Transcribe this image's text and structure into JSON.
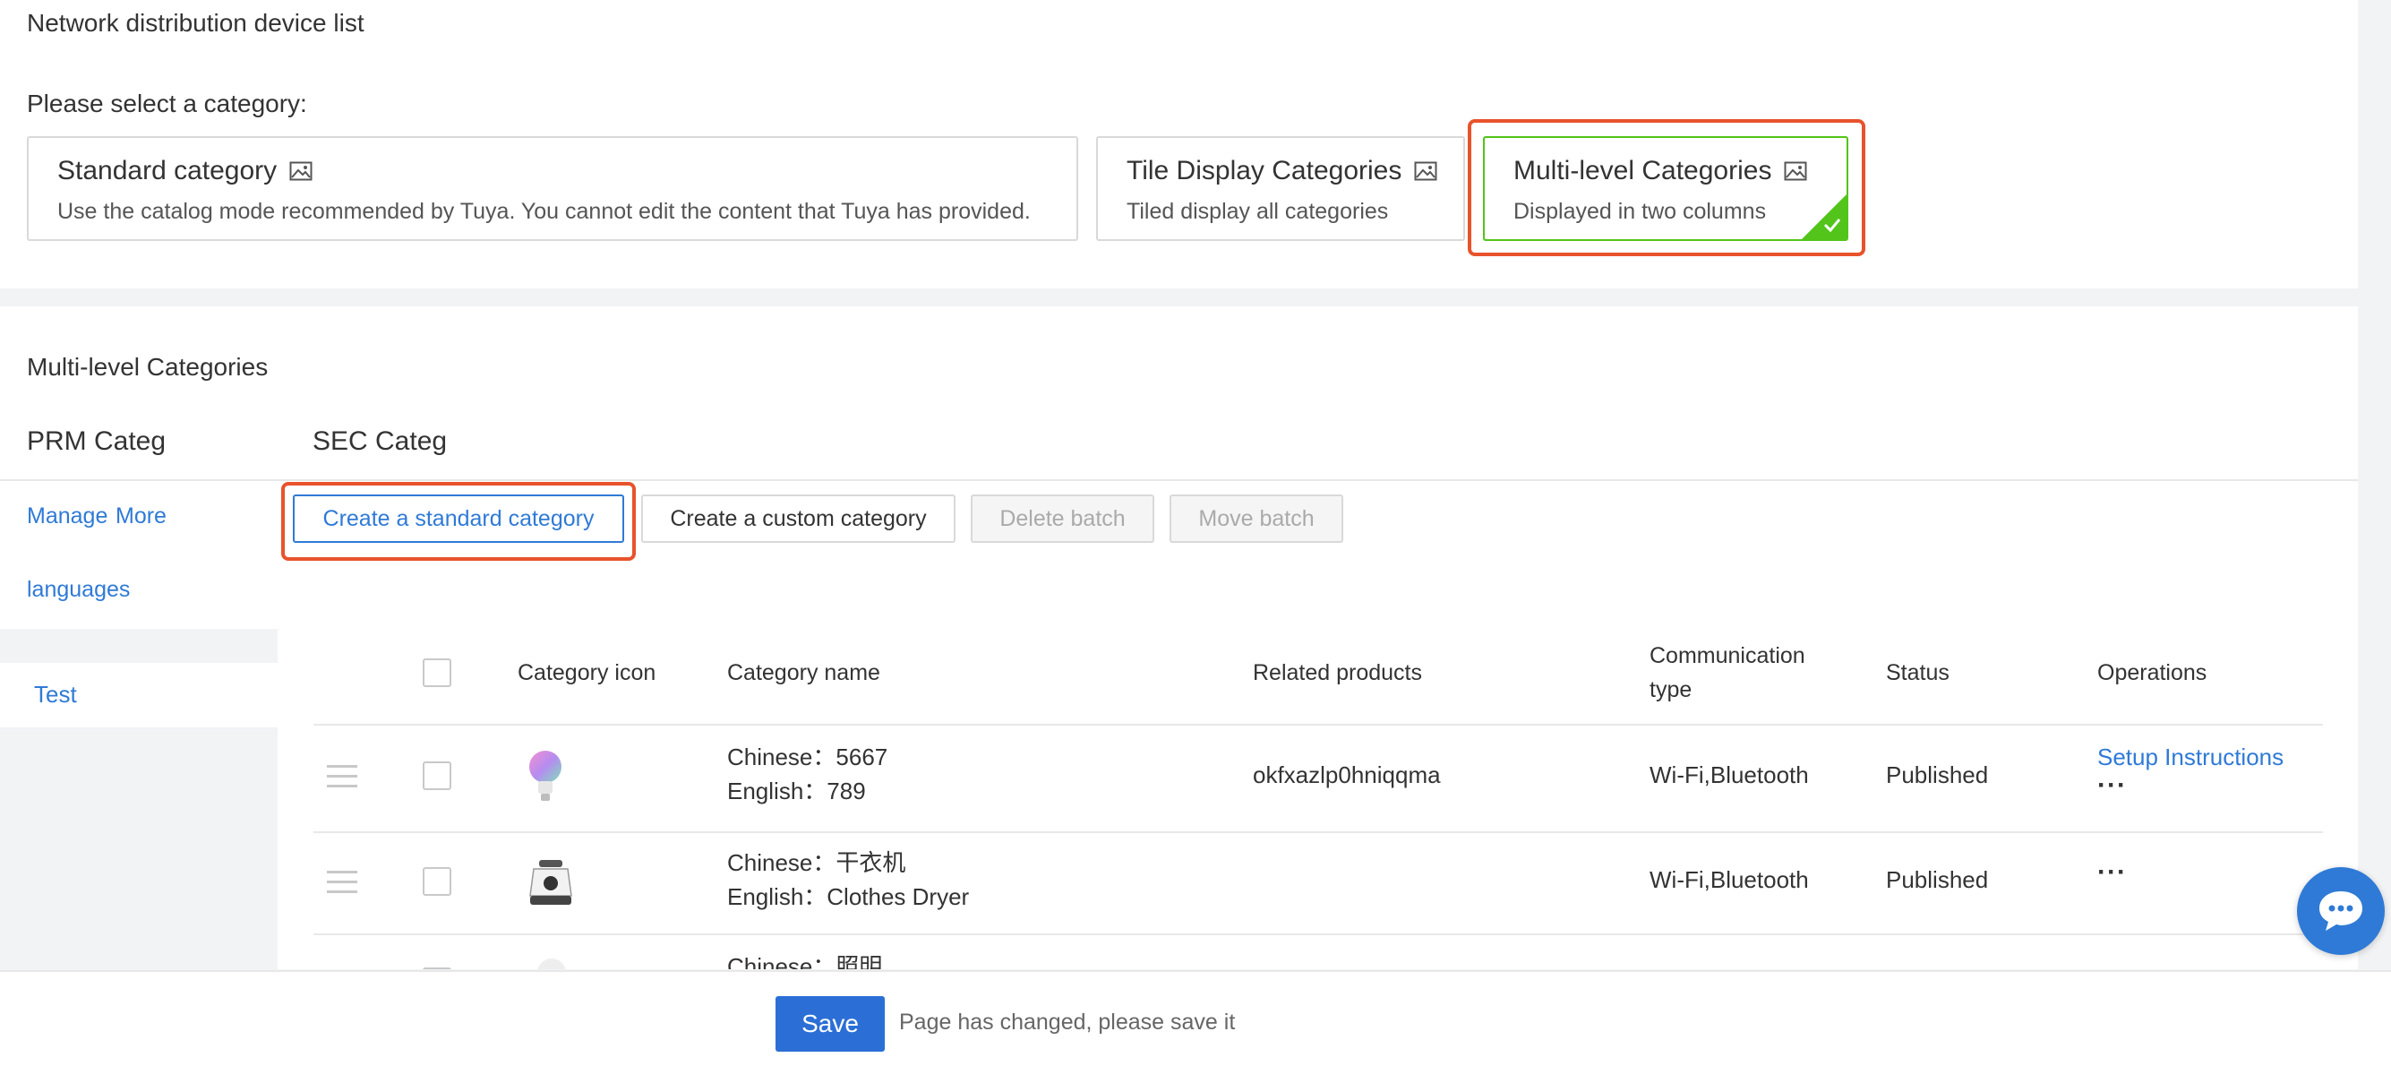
{
  "page": {
    "heading": "Network distribution device list",
    "select_label": "Please select a category:"
  },
  "category_modes": [
    {
      "title": "Standard category",
      "desc": "Use the catalog mode recommended by Tuya. You cannot edit the content that Tuya has provided.",
      "icon": "image-icon",
      "selected": false
    },
    {
      "title": "Tile Display Categories",
      "desc": "Tiled display all categories",
      "icon": "image-icon",
      "selected": false
    },
    {
      "title": "Multi-level Categories",
      "desc": "Displayed in two columns",
      "icon": "image-icon",
      "selected": true
    }
  ],
  "multi": {
    "section_title": "Multi-level Categories",
    "prm_heading": "PRM Categ",
    "sec_heading": "SEC Categ",
    "manage_link": "Manage",
    "more_link": "More",
    "languages_link": "languages"
  },
  "toolbar": {
    "create_standard": "Create a standard category",
    "create_custom": "Create a custom category",
    "delete_batch": "Delete batch",
    "move_batch": "Move batch"
  },
  "sidebar": {
    "items": [
      {
        "label": "Test",
        "active": true
      }
    ]
  },
  "table": {
    "headers": {
      "icon": "Category icon",
      "name": "Category name",
      "products": "Related products",
      "comm_line1": "Communication",
      "comm_line2": "type",
      "status": "Status",
      "operations": "Operations"
    },
    "rows": [
      {
        "icon": "bulb-icon",
        "chinese": "Chinese：5667",
        "english": "English：789",
        "products": "okfxazlp0hniqqma",
        "comm": "Wi-Fi,Bluetooth",
        "status": "Published",
        "op_link": "Setup Instructions",
        "more": "···"
      },
      {
        "icon": "dryer-icon",
        "chinese": "Chinese：干衣机",
        "english": "English：Clothes Dryer",
        "products": "",
        "comm": "Wi-Fi,Bluetooth",
        "status": "Published",
        "op_link": "",
        "more": "···"
      },
      {
        "icon": "lighting-icon",
        "chinese": "Chinese：照明",
        "english": "",
        "products": "",
        "comm": "",
        "status": "",
        "op_link": "",
        "more": ""
      }
    ]
  },
  "footer": {
    "save_label": "Save",
    "note": "Page has changed, please save it"
  },
  "colors": {
    "accent": "#2f7ad6",
    "highlight_frame": "#e8532b",
    "selected_border": "#52c41a",
    "save_button": "#2b6fd6"
  }
}
